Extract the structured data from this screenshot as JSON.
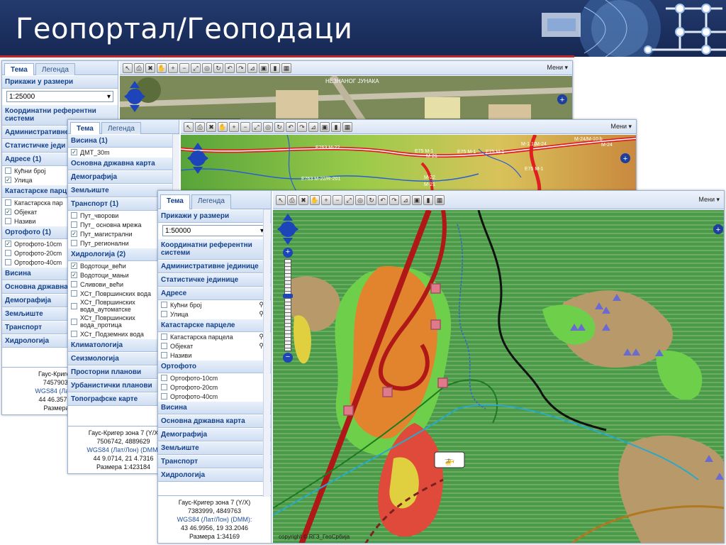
{
  "slide": {
    "title": "Геопортал/Геоподаци"
  },
  "win1": {
    "tabs": [
      "Тема",
      "Легенда"
    ],
    "sections": {
      "scale_header": "Прикажи у размери",
      "scale_value": "1:25000",
      "ref_systems": "Координатни референтни системи",
      "admin": "Административне",
      "stat": "Статистичке једи",
      "addresses": "Адресе (1)",
      "addr_items": [
        "Кућни број",
        "Улица"
      ],
      "cadastre": "Катастарске парц",
      "cad_items": [
        "Катастарска пар",
        "Објекат",
        "Називи"
      ],
      "ortho": "Ортофото (1)",
      "ortho_items": [
        "Ортофото-10cm",
        "Ортофото-20cm",
        "Ортофото-40cm"
      ],
      "height": "Висина",
      "base_map": "Основна државна",
      "demography": "Демографија",
      "land": "Земљиште",
      "transport": "Транспорт",
      "hydro": "Хидрологија"
    },
    "footer": {
      "line1": "Гаус-Кригер зо",
      "line2": "7457903, 4!",
      "line3": "WGS84 (Лат/Лон",
      "line4": "44 46.3578, 20",
      "line5": "Размера 1:"
    },
    "menu": "Мени ▾",
    "map_label": "НЕЗНАНОГ ЈУНАКА"
  },
  "win2": {
    "tabs": [
      "Тема",
      "Легенда"
    ],
    "sections": {
      "height": "Висина (1)",
      "height_items": [
        "ДМТ_30m"
      ],
      "base_map": "Основна државна карта",
      "demography": "Демографија",
      "land": "Земљиште",
      "transport": "Транспорт (1)",
      "transport_items": [
        "Пут_чворови",
        "Пут_ основна мрежа",
        "Пут_магистрални",
        "Пут_регионални"
      ],
      "hydro": "Хидрологија (2)",
      "hydro_items": [
        "Водотоци_већи",
        "Водотоци_мањи",
        "Сливови_већи",
        "ХСт_Површинских вода",
        "ХСт_Површинских вода_аутоматске",
        "ХСт_Површинских вода_протица",
        "ХСт_Подземних вода"
      ],
      "climate": "Климатологија",
      "seismo": "Сеизмологија",
      "spatial": "Просторни планови",
      "urban": "Урбанистички планови",
      "topo": "Топографске карте"
    },
    "footer": {
      "line1": "Гаус-Кригер зона 7 (Y/X",
      "line2": "7506742, 4889629",
      "line3": "WGS84 (Лат/Лон) (DMM)",
      "line4": "44 9.0714, 21 4.7316",
      "line5": "Размера 1:423184"
    },
    "menu": "Мени ▾",
    "road_labels": [
      "E763 M-22",
      "E75 M-1",
      "E75 M-1",
      "E75 M-1",
      "M-1.10",
      "M-24",
      "M-24/M-10.b",
      "M-24",
      "M-21",
      "M-22",
      "M-21",
      "E763 M-22/R-201",
      "E75 M-1"
    ]
  },
  "win3": {
    "tabs": [
      "Тема",
      "Легенда"
    ],
    "sections": {
      "scale_header": "Прикажи у размери",
      "scale_value": "1:50000",
      "ref_systems": "Координатни референтни системи",
      "admin": "Административне јединице",
      "stat": "Статистичке јединице",
      "addresses": "Адресе",
      "addr_items": [
        "Кућни број",
        "Улица"
      ],
      "cadastre": "Катастарске парцеле",
      "cad_items": [
        "Катастарска парцела",
        "Објекат",
        "Називи"
      ],
      "ortho": "Ортофото",
      "ortho_items": [
        "Ортофото-10cm",
        "Ортофото-20cm",
        "Ортофото-40cm"
      ],
      "height": "Висина",
      "base_map": "Основна државна карта",
      "demography": "Демографија",
      "land": "Земљиште",
      "transport": "Транспорт",
      "hydro": "Хидрологија"
    },
    "footer": {
      "line1": "Гаус-Кригер зона 7 (Y/X)",
      "line2": "7383999, 4849763",
      "line3": "WGS84 (Лат/Лон) (DMM):",
      "line4": "43 46.9956, 19 33.2046",
      "line5": "Размера 1:34169"
    },
    "menu": "Мени ▾",
    "copyright": "copyright © RГЗ_ГеоСрбија"
  },
  "colors": {
    "banner": "#1b2f5e",
    "accent_red": "#c0272d",
    "panel_header": "#15428b",
    "link": "#1f4f9f"
  }
}
